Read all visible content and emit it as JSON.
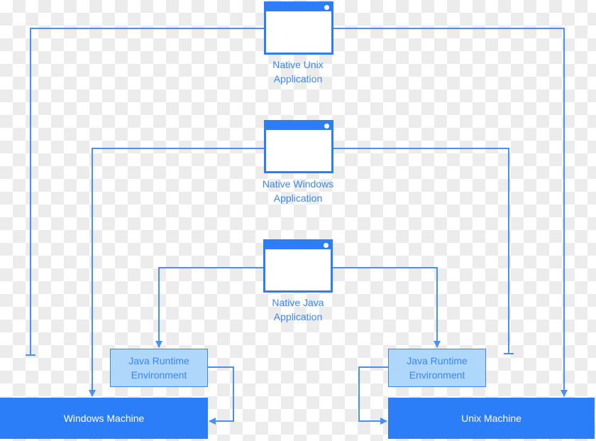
{
  "colors": {
    "accent": "#2e7df7",
    "line": "#4a8ff7",
    "jre_fill": "#aed7fb",
    "label_text": "#3b86f5",
    "machine_fill": "#2b7ef7"
  },
  "applications": [
    {
      "id": "native-unix",
      "line1": "Native Unix",
      "line2": "Application",
      "icon": "app-window-icon"
    },
    {
      "id": "native-windows",
      "line1": "Native Windows",
      "line2": "Application",
      "icon": "app-window-icon"
    },
    {
      "id": "native-java",
      "line1": "Native Java",
      "line2": "Application",
      "icon": "app-window-icon"
    }
  ],
  "runtimes": [
    {
      "id": "jre-windows",
      "line1": "Java Runtime",
      "line2": "Environment"
    },
    {
      "id": "jre-unix",
      "line1": "Java Runtime",
      "line2": "Environment"
    }
  ],
  "machines": [
    {
      "id": "windows-machine",
      "label": "Windows Machine"
    },
    {
      "id": "unix-machine",
      "label": "Unix Machine"
    }
  ],
  "connections": [
    {
      "from": "native-unix",
      "to": "windows-machine",
      "type": "blocked"
    },
    {
      "from": "native-unix",
      "to": "unix-machine",
      "type": "arrow"
    },
    {
      "from": "native-windows",
      "to": "windows-machine",
      "type": "arrow"
    },
    {
      "from": "native-windows",
      "to": "unix-machine",
      "type": "blocked"
    },
    {
      "from": "native-java",
      "to": "jre-windows",
      "type": "arrow"
    },
    {
      "from": "native-java",
      "to": "jre-unix",
      "type": "arrow"
    },
    {
      "from": "jre-windows",
      "to": "windows-machine",
      "type": "arrow"
    },
    {
      "from": "jre-unix",
      "to": "unix-machine",
      "type": "arrow"
    }
  ]
}
